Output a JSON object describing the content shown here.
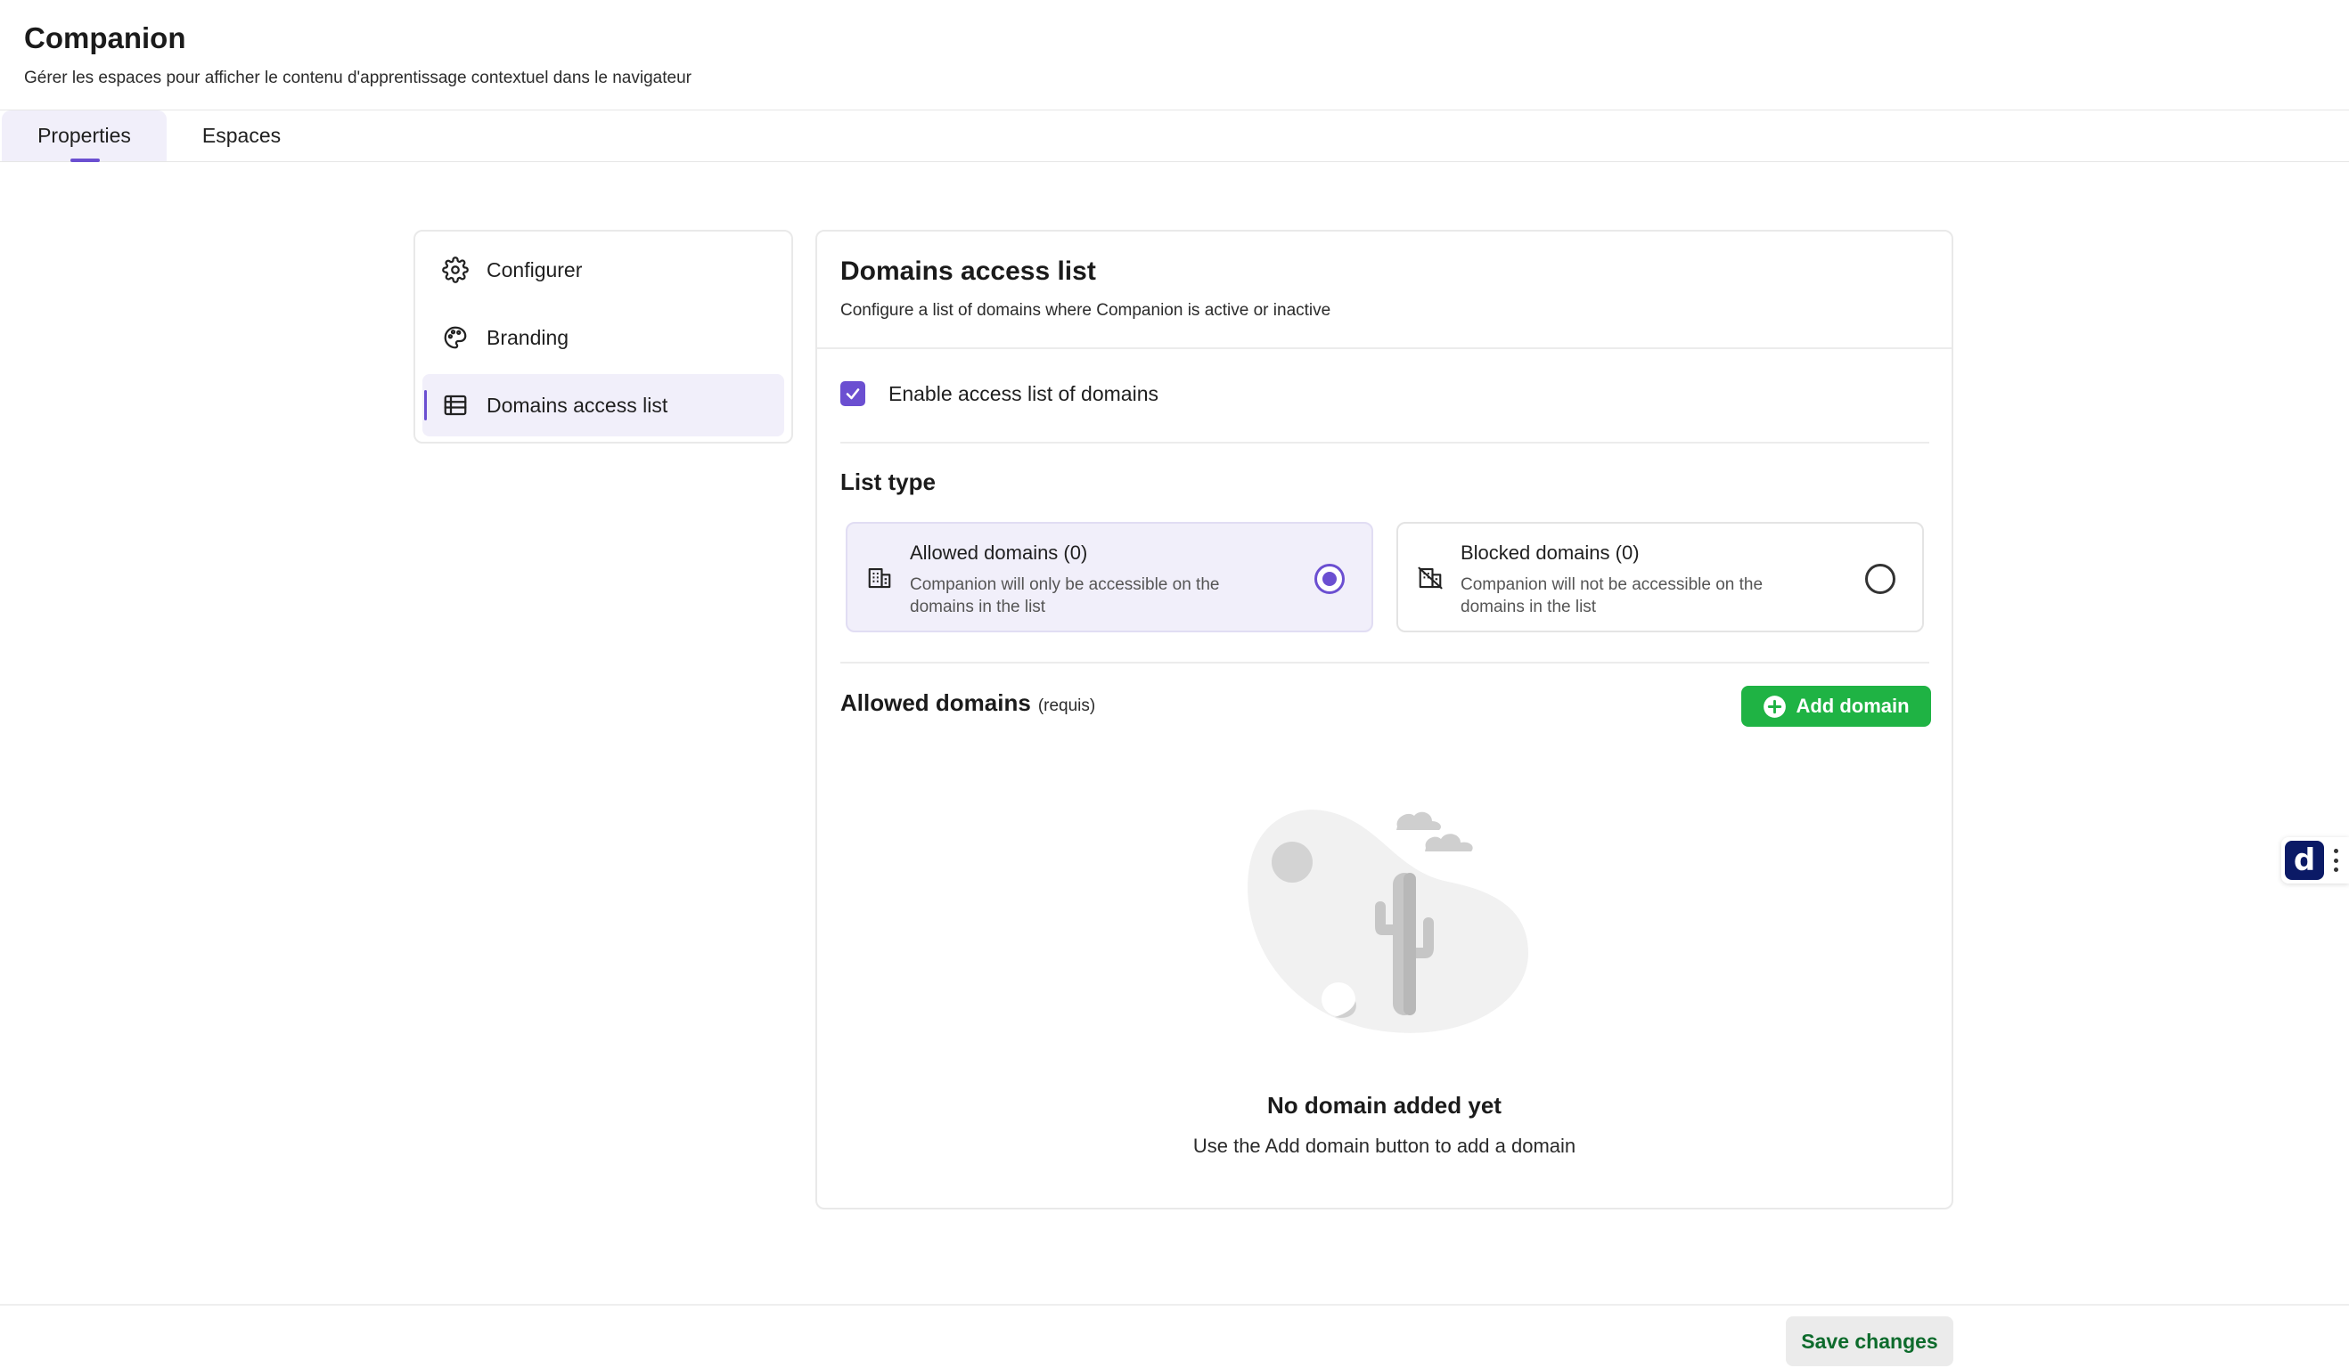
{
  "app": {
    "title": "Companion",
    "subtitle": "Gérer les espaces pour afficher le contenu d'apprentissage contextuel dans le navigateur"
  },
  "tabs": [
    {
      "label": "Properties",
      "active": true
    },
    {
      "label": "Espaces",
      "active": false
    }
  ],
  "sidebar": {
    "items": [
      {
        "label": "Configurer",
        "icon": "gear-icon",
        "active": false
      },
      {
        "label": "Branding",
        "icon": "palette-icon",
        "active": false
      },
      {
        "label": "Domains access list",
        "icon": "table-list-icon",
        "active": true
      }
    ]
  },
  "main": {
    "title": "Domains access list",
    "subtitle": "Configure a list of domains where Companion is active or inactive",
    "enable_checkbox": {
      "label": "Enable access list of domains",
      "checked": true
    },
    "list_type": {
      "label": "List type",
      "options": [
        {
          "title": "Allowed domains (0)",
          "description": "Companion will only be accessible on the domains in the list",
          "icon": "building-icon",
          "selected": true
        },
        {
          "title": "Blocked domains (0)",
          "description": "Companion will not be accessible on the domains in the list",
          "icon": "building-off-icon",
          "selected": false
        }
      ]
    },
    "allowed_domains": {
      "title": "Allowed domains",
      "required_label": "(requis)",
      "add_button_label": "Add domain"
    },
    "empty_state": {
      "title": "No domain added yet",
      "description": "Use the Add domain button to add a domain",
      "illustration": "desert-cactus-illustration"
    }
  },
  "footer": {
    "save_label": "Save changes"
  },
  "widget": {
    "logo_letter": "d"
  },
  "colors": {
    "accent": "#6b4fd1",
    "accent_soft": "#f1effa",
    "success": "#1fb344",
    "save_text": "#0d6b2c"
  }
}
